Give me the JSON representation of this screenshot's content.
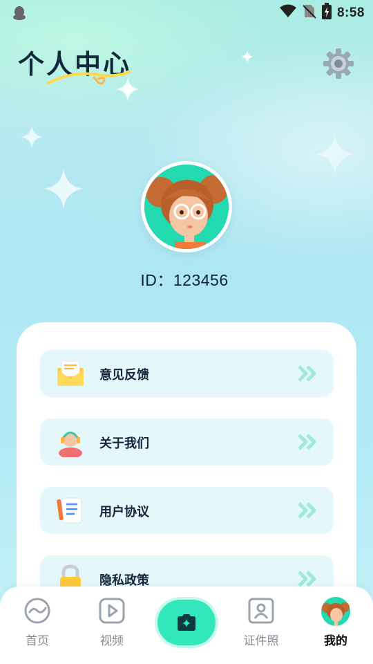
{
  "status_bar": {
    "time": "8:58",
    "icons": [
      "qq-penguin-icon",
      "wifi-icon",
      "no-sim-icon",
      "battery-charging-icon"
    ]
  },
  "header": {
    "title": "个人中心",
    "settings_icon": "gear-icon"
  },
  "profile": {
    "avatar": "cartoon-girl-avatar",
    "id_text": "ID：123456"
  },
  "menu": {
    "items": [
      {
        "label": "意见反馈",
        "icon": "envelope-icon"
      },
      {
        "label": "关于我们",
        "icon": "headset-person-icon"
      },
      {
        "label": "用户协议",
        "icon": "document-pencil-icon"
      },
      {
        "label": "隐私政策",
        "icon": "padlock-icon"
      }
    ],
    "arrow_icon": "double-chevron-right-icon"
  },
  "tab_bar": {
    "tabs": [
      {
        "label": "首页",
        "icon": "home-swirl-icon",
        "active": false
      },
      {
        "label": "视频",
        "icon": "play-icon",
        "active": false
      },
      {
        "label": "",
        "icon": "camera-icon",
        "active": false
      },
      {
        "label": "证件照",
        "icon": "id-photo-icon",
        "active": false
      },
      {
        "label": "我的",
        "icon": "avatar-icon",
        "active": true
      }
    ]
  },
  "colors": {
    "accent": "#33e7bd",
    "menu_item_bg": "#e4f7fb",
    "arrow": "#9ee9db",
    "title": "#102a3c"
  }
}
